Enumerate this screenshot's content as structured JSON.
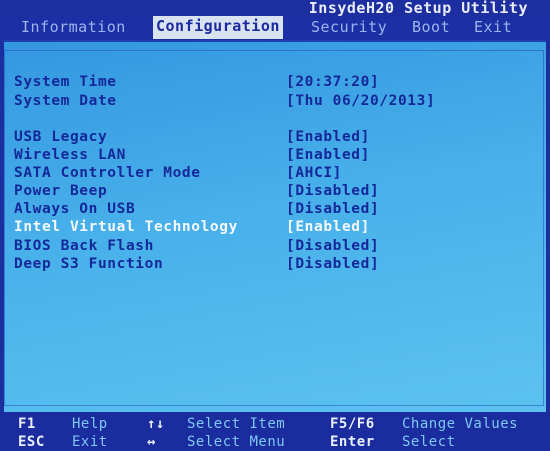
{
  "title": "InsydeH20 Setup Utility",
  "tabs": [
    {
      "label": "Information"
    },
    {
      "label": "Configuration"
    },
    {
      "label": "Security"
    },
    {
      "label": "Boot"
    },
    {
      "label": "Exit"
    }
  ],
  "active_tab": "Configuration",
  "settings": [
    {
      "label": "System Time",
      "value": "[20:37:20]"
    },
    {
      "label": "System Date",
      "value": "[Thu 06/20/2013]"
    },
    {
      "label": "USB Legacy",
      "value": "[Enabled]"
    },
    {
      "label": "Wireless LAN",
      "value": "[Enabled]"
    },
    {
      "label": "SATA Controller Mode",
      "value": "[AHCI]"
    },
    {
      "label": "Power Beep",
      "value": "[Disabled]"
    },
    {
      "label": "Always On USB",
      "value": "[Disabled]"
    },
    {
      "label": "Intel Virtual Technology",
      "value": "[Enabled]"
    },
    {
      "label": "BIOS Back Flash",
      "value": "[Disabled]"
    },
    {
      "label": "Deep S3 Function",
      "value": "[Disabled]"
    }
  ],
  "highlighted_setting": "Intel Virtual Technology",
  "footer": {
    "row1": [
      {
        "key": "F1",
        "desc": "Help"
      },
      {
        "key": "↑↓",
        "desc": "Select Item"
      },
      {
        "key": "F5/F6",
        "desc": "Change Values"
      }
    ],
    "row2": [
      {
        "key": "ESC",
        "desc": "Exit"
      },
      {
        "key": "↔",
        "desc": "Select Menu"
      },
      {
        "key": "Enter",
        "desc": "Select"
      }
    ]
  },
  "colors": {
    "background": "#1b2fa0",
    "panel": "#48b0ea",
    "text": "#15289a",
    "highlight_text": "#f4f8ff",
    "active_tab_bg": "#d8e2f0"
  }
}
